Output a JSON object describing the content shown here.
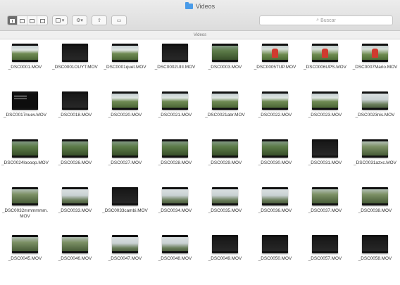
{
  "window": {
    "title": "Videos",
    "path_label": "Videos",
    "search_placeholder": "Buscar"
  },
  "toolbar": {
    "arrange_label": "▾",
    "action_label": "⚙▾",
    "share_label": "⇧",
    "tags_label": "▭"
  },
  "icons": {
    "folder": "folder-icon",
    "search": "magnifier-icon"
  },
  "colors": {
    "folder": "#4a9be8",
    "active_view": "#6e6e6e"
  },
  "files": [
    {
      "name": "_DSC0001.MOV",
      "thumb": "land"
    },
    {
      "name": "_DSC0001OUYT.MOV",
      "thumb": "dark"
    },
    {
      "name": "_DSC0001quet.MOV",
      "thumb": "land"
    },
    {
      "name": "_DSC0002UIII.MOV",
      "thumb": "dark"
    },
    {
      "name": "_DSC0003.MOV",
      "thumb": "forest"
    },
    {
      "name": "_DSC0005TUP.MOV",
      "thumb": "red"
    },
    {
      "name": "_DSC0006UPS.MOV",
      "thumb": "red"
    },
    {
      "name": "_DSC0007Mario.MOV",
      "thumb": "red"
    },
    {
      "name": "_DSC0017nuev.MOV",
      "thumb": "night"
    },
    {
      "name": "_DSC0018.MOV",
      "thumb": "dark"
    },
    {
      "name": "_DSC0020.MOV",
      "thumb": "land"
    },
    {
      "name": "_DSC0021.MOV",
      "thumb": "land"
    },
    {
      "name": "_DSC0021abr.MOV",
      "thumb": "land"
    },
    {
      "name": "_DSC0022.MOV",
      "thumb": "land"
    },
    {
      "name": "_DSC0023.MOV",
      "thumb": "land"
    },
    {
      "name": "_DSC0023nis.MOV",
      "thumb": "sky"
    },
    {
      "name": "_DSC0024loooop.MOV",
      "thumb": "forest"
    },
    {
      "name": "_DSC0026.MOV",
      "thumb": "forest"
    },
    {
      "name": "_DSC0027.MOV",
      "thumb": "forest"
    },
    {
      "name": "_DSC0028.MOV",
      "thumb": "forest"
    },
    {
      "name": "_DSC0029.MOV",
      "thumb": "forest"
    },
    {
      "name": "_DSC0030.MOV",
      "thumb": "forest"
    },
    {
      "name": "_DSC0031.MOV",
      "thumb": "dark"
    },
    {
      "name": "_DSC0031azxc.MOV",
      "thumb": "trees"
    },
    {
      "name": "_DSC0032mmmmmm.MOV",
      "thumb": "trees"
    },
    {
      "name": "_DSC0033.MOV",
      "thumb": "sky"
    },
    {
      "name": "_DSC0033cambi.MOV",
      "thumb": "dark"
    },
    {
      "name": "_DSC0034.MOV",
      "thumb": "sky"
    },
    {
      "name": "_DSC0035.MOV",
      "thumb": "sky"
    },
    {
      "name": "_DSC0036.MOV",
      "thumb": "sky"
    },
    {
      "name": "_DSC0037.MOV",
      "thumb": "trees"
    },
    {
      "name": "_DSC0038.MOV",
      "thumb": "trees"
    },
    {
      "name": "_DSC0045.MOV",
      "thumb": "trees"
    },
    {
      "name": "_DSC0046.MOV",
      "thumb": "trees"
    },
    {
      "name": "_DSC0047.MOV",
      "thumb": "sky"
    },
    {
      "name": "_DSC0048.MOV",
      "thumb": "sky"
    },
    {
      "name": "_DSC0049.MOV",
      "thumb": "dark"
    },
    {
      "name": "_DSC0050.MOV",
      "thumb": "dark"
    },
    {
      "name": "_DSC0057.MOV",
      "thumb": "dark"
    },
    {
      "name": "_DSC0058.MOV",
      "thumb": "dark"
    }
  ]
}
